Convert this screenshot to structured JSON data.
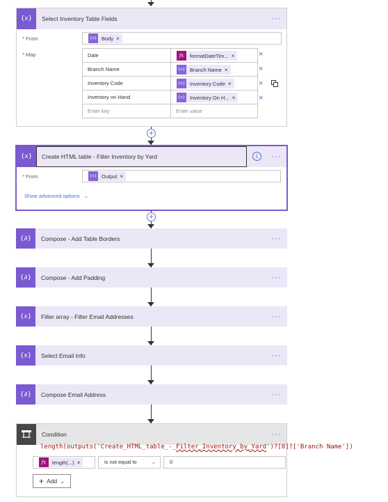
{
  "select_inventory": {
    "title": "Select Inventory Table Fields",
    "from_label": "From",
    "from_token": "Body",
    "map_label": "Map",
    "rows": [
      {
        "key": "Date",
        "value": "formatDateTim...",
        "value_kind": "fx"
      },
      {
        "key": "Branch Name",
        "value": "Branch Name",
        "value_kind": "var"
      },
      {
        "key": "Inventory Code",
        "value": "Inventory Code",
        "value_kind": "var"
      },
      {
        "key": "Inventory on Hand",
        "value": "Inventory On H...",
        "value_kind": "var"
      }
    ],
    "key_placeholder": "Enter key",
    "value_placeholder": "Enter value"
  },
  "create_html": {
    "title": "Create HTML table - Filter Inventory by Yard",
    "from_label": "From",
    "from_token": "Output",
    "advanced_link": "Show advanced options"
  },
  "collapsed_steps": [
    {
      "title": "Compose - Add Table Borders",
      "icon": "compose-icon"
    },
    {
      "title": "Compose - Add Padding",
      "icon": "compose-icon"
    },
    {
      "title": "Filter array - Filter Email Addresses",
      "icon": "filter-icon"
    },
    {
      "title": "Select Email Info",
      "icon": "select-icon"
    },
    {
      "title": "Compose Email Address",
      "icon": "compose-icon"
    }
  ],
  "condition": {
    "title": "Condition",
    "expression_prefix": "length(outputs('Create_HTML_table_-_",
    "expression_squiggle": "Filter_Inventory_by_Yard",
    "expression_suffix": "')?[0]?['Branch Name'])",
    "left_token": "length(...)",
    "operator": "is not equal to",
    "right_value": "0",
    "add_label": "Add"
  },
  "icons": {
    "var": "{x}",
    "fx": "fx",
    "compose": "{∂}",
    "dots": "···",
    "close": "×"
  },
  "colors": {
    "accent": "#7a59d1",
    "header_bg": "#ebe7f7",
    "link": "#4b6fd0",
    "fx_token": "#a0127c",
    "condition_icon": "#484644"
  }
}
